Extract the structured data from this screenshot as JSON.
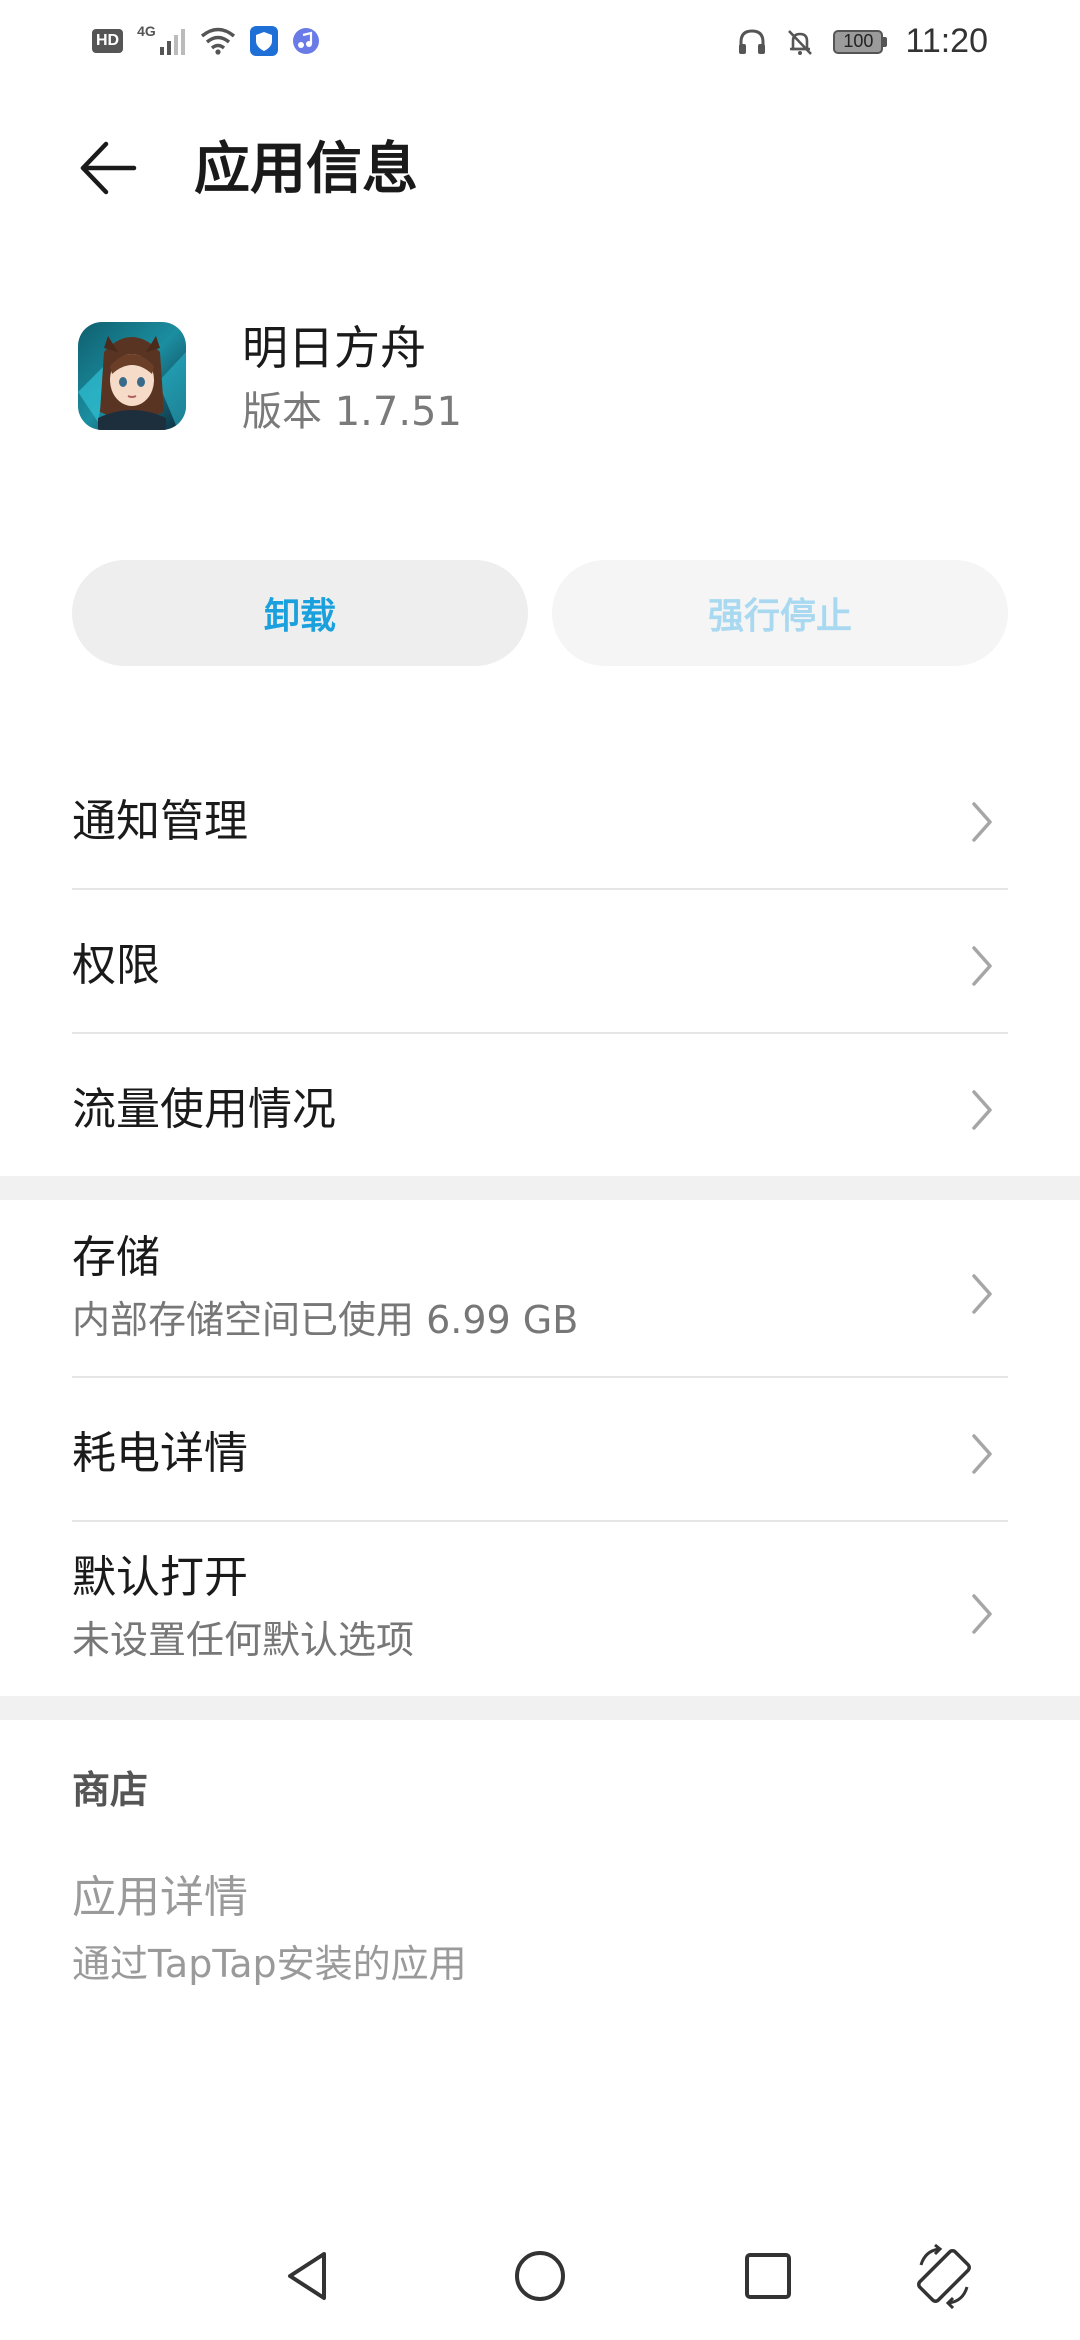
{
  "status_bar": {
    "hd": "HD",
    "network": "4G",
    "battery": "100",
    "time": "11:20"
  },
  "header": {
    "title": "应用信息",
    "back_icon": "back-arrow-icon"
  },
  "app": {
    "name": "明日方舟",
    "version": "版本 1.7.51"
  },
  "buttons": {
    "uninstall": "卸载",
    "force_stop": "强行停止"
  },
  "settings": {
    "notifications": "通知管理",
    "permissions": "权限",
    "data_usage": "流量使用情况",
    "storage": {
      "title": "存储",
      "subtitle": "内部存储空间已使用 6.99 GB"
    },
    "battery": "耗电详情",
    "open_by_default": {
      "title": "默认打开",
      "subtitle": "未设置任何默认选项"
    }
  },
  "store": {
    "section": "商店",
    "title": "应用详情",
    "subtitle": "通过TapTap安装的应用"
  },
  "colors": {
    "accent": "#1aa0dc",
    "accent_disabled": "#a8d9f0",
    "divider": "#e6e6e6"
  }
}
